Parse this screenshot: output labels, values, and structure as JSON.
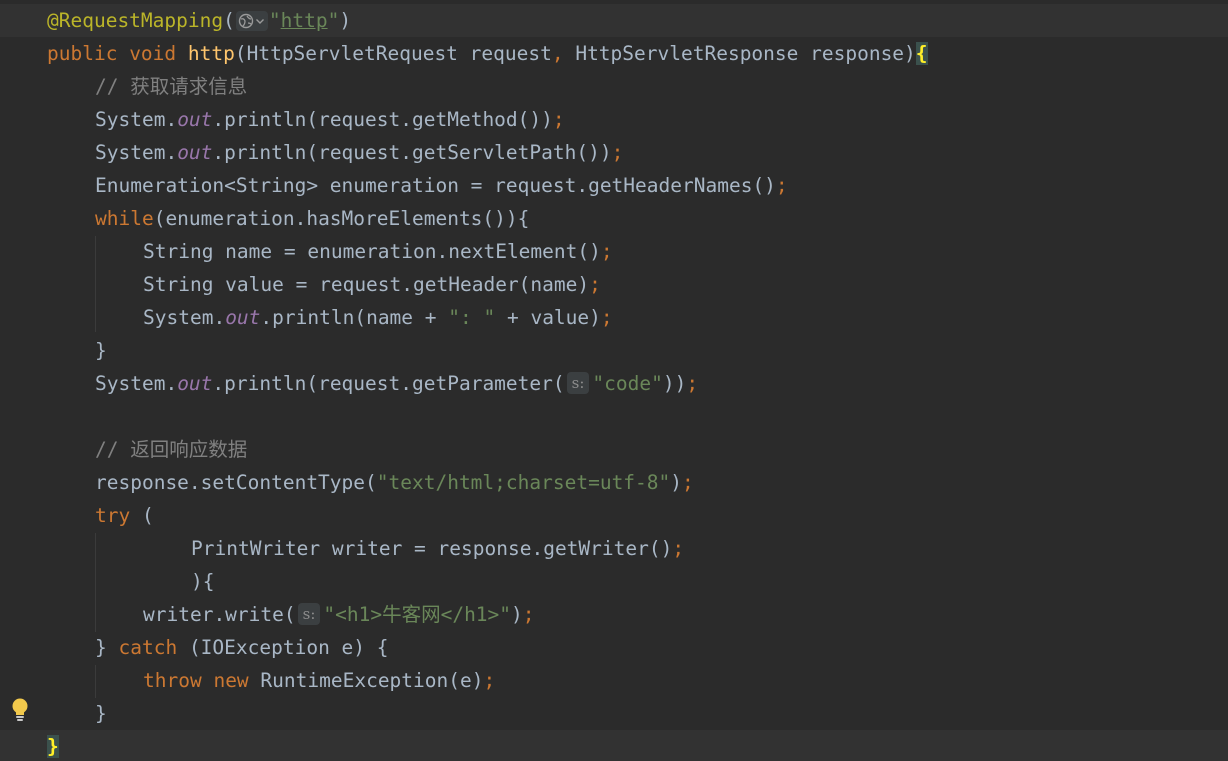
{
  "lines": [
    {
      "tokens": [
        {
          "t": "@RequestMapping",
          "c": "ann"
        },
        {
          "t": "(",
          "c": "plain"
        },
        {
          "hint": "globe"
        },
        {
          "t": "\"",
          "c": "str"
        },
        {
          "t": "http",
          "c": "link"
        },
        {
          "t": "\"",
          "c": "str"
        },
        {
          "t": ")",
          "c": "plain"
        }
      ]
    },
    {
      "tokens": [
        {
          "t": "public ",
          "c": "kw"
        },
        {
          "t": "void ",
          "c": "kw"
        },
        {
          "t": "http",
          "c": "fn"
        },
        {
          "t": "(HttpServletRequest request",
          "c": "plain"
        },
        {
          "t": ", ",
          "c": "punc"
        },
        {
          "t": "HttpServletResponse response)",
          "c": "plain"
        },
        {
          "t": "{",
          "c": "brace-hl"
        }
      ]
    },
    {
      "tokens": [
        {
          "t": "// ",
          "c": "cm"
        },
        {
          "t": "获取请求信息",
          "c": "cm"
        }
      ]
    },
    {
      "tokens": [
        {
          "t": "System.",
          "c": "plain"
        },
        {
          "t": "out",
          "c": "field"
        },
        {
          "t": ".println(request.getMethod())",
          "c": "plain"
        },
        {
          "t": ";",
          "c": "punc"
        }
      ]
    },
    {
      "tokens": [
        {
          "t": "System.",
          "c": "plain"
        },
        {
          "t": "out",
          "c": "field"
        },
        {
          "t": ".println(request.getServletPath())",
          "c": "plain"
        },
        {
          "t": ";",
          "c": "punc"
        }
      ]
    },
    {
      "tokens": [
        {
          "t": "Enumeration<String> enumeration = request.getHeaderNames()",
          "c": "plain"
        },
        {
          "t": ";",
          "c": "punc"
        }
      ]
    },
    {
      "tokens": [
        {
          "t": "while",
          "c": "kw"
        },
        {
          "t": "(enumeration.hasMoreElements()){",
          "c": "plain"
        }
      ]
    },
    {
      "tokens": [
        {
          "t": "String name = enumeration.nextElement()",
          "c": "plain"
        },
        {
          "t": ";",
          "c": "punc"
        }
      ]
    },
    {
      "tokens": [
        {
          "t": "String value = request.getHeader(name)",
          "c": "plain"
        },
        {
          "t": ";",
          "c": "punc"
        }
      ]
    },
    {
      "tokens": [
        {
          "t": "System.",
          "c": "plain"
        },
        {
          "t": "out",
          "c": "field"
        },
        {
          "t": ".println(name + ",
          "c": "plain"
        },
        {
          "t": "\": \"",
          "c": "str"
        },
        {
          "t": " + value)",
          "c": "plain"
        },
        {
          "t": ";",
          "c": "punc"
        }
      ]
    },
    {
      "tokens": [
        {
          "t": "}",
          "c": "plain"
        }
      ]
    },
    {
      "tokens": [
        {
          "t": "System.",
          "c": "plain"
        },
        {
          "t": "out",
          "c": "field"
        },
        {
          "t": ".println(request.getParameter(",
          "c": "plain"
        },
        {
          "hint": "text",
          "label": "s:"
        },
        {
          "t": "\"code\"",
          "c": "str"
        },
        {
          "t": "))",
          "c": "plain"
        },
        {
          "t": ";",
          "c": "punc"
        }
      ]
    },
    {
      "tokens": []
    },
    {
      "tokens": [
        {
          "t": "// ",
          "c": "cm"
        },
        {
          "t": "返回响应数据",
          "c": "cm"
        }
      ]
    },
    {
      "tokens": [
        {
          "t": "response.setContentType(",
          "c": "plain"
        },
        {
          "t": "\"text/html;charset=utf-8\"",
          "c": "str"
        },
        {
          "t": ")",
          "c": "plain"
        },
        {
          "t": ";",
          "c": "punc"
        }
      ]
    },
    {
      "tokens": [
        {
          "t": "try ",
          "c": "kw"
        },
        {
          "t": "(",
          "c": "plain"
        }
      ]
    },
    {
      "tokens": [
        {
          "t": "PrintWriter writer = response.getWriter()",
          "c": "plain"
        },
        {
          "t": ";",
          "c": "punc"
        }
      ]
    },
    {
      "tokens": [
        {
          "t": "){",
          "c": "plain"
        }
      ]
    },
    {
      "tokens": [
        {
          "t": "writer.write(",
          "c": "plain"
        },
        {
          "hint": "text",
          "label": "s:"
        },
        {
          "t": "\"<h1>牛客网</h1>\"",
          "c": "str"
        },
        {
          "t": ")",
          "c": "plain"
        },
        {
          "t": ";",
          "c": "punc"
        }
      ]
    },
    {
      "tokens": [
        {
          "t": "} ",
          "c": "plain"
        },
        {
          "t": "catch ",
          "c": "kw"
        },
        {
          "t": "(IOException e) {",
          "c": "plain"
        }
      ]
    },
    {
      "tokens": [
        {
          "t": "throw ",
          "c": "kw"
        },
        {
          "t": "new ",
          "c": "kw"
        },
        {
          "t": "RuntimeException(e)",
          "c": "plain"
        },
        {
          "t": ";",
          "c": "punc"
        }
      ]
    },
    {
      "tokens": [
        {
          "t": "}",
          "c": "plain"
        }
      ]
    },
    {
      "tokens": [
        {
          "t": "}",
          "c": "brace-hl"
        }
      ]
    }
  ],
  "icons": {
    "gutter": "lightbulb-icon",
    "url_hint": "globe-icon"
  },
  "colors": {
    "background": "#2b2b2b",
    "keyword": "#cc7832",
    "annotation": "#bbb529",
    "method_declaration": "#ffc66d",
    "string": "#6a8759",
    "static_field": "#9876aa",
    "comment": "#808080",
    "text": "#a9b7c6",
    "brace_highlight": "#ffef28"
  }
}
